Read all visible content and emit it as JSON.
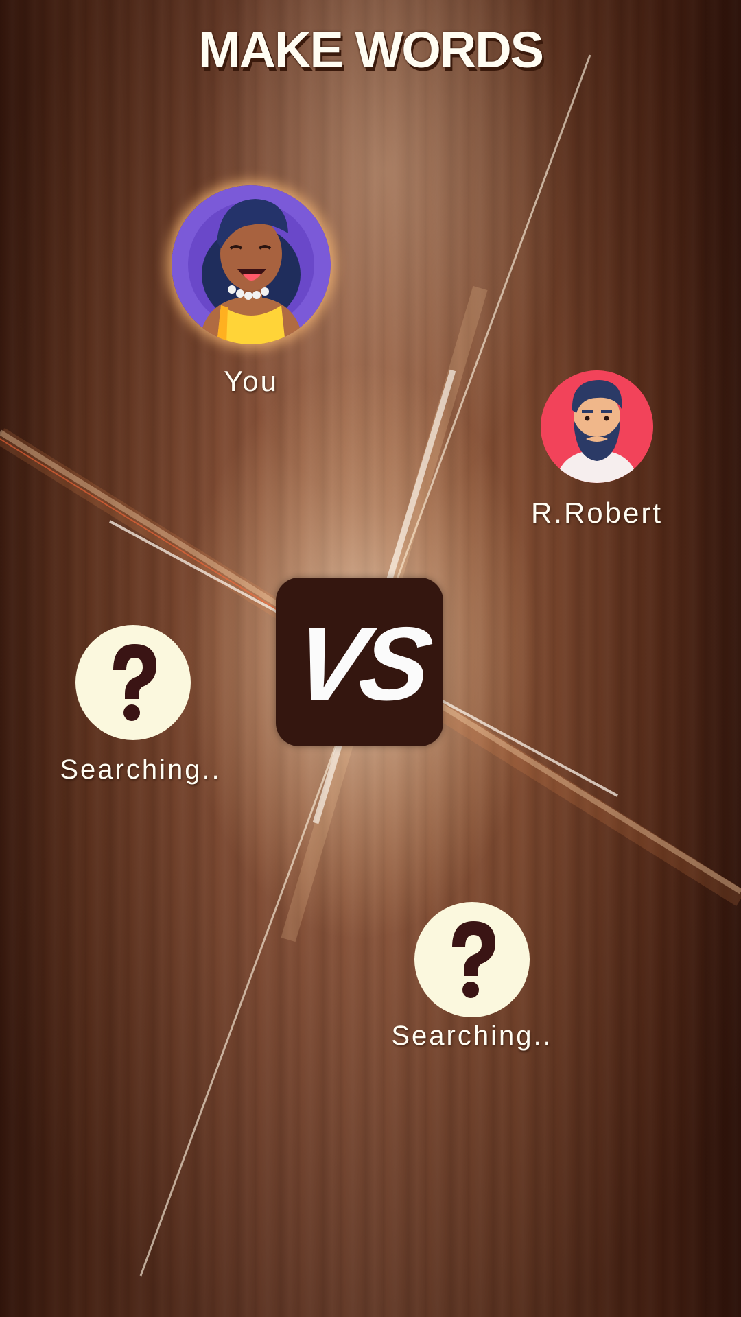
{
  "title": "MAKE WORDS",
  "players": {
    "you": {
      "name": "You",
      "avatar_icon": "woman-avatar-icon"
    },
    "opponent": {
      "name": "R.Robert",
      "avatar_icon": "bearded-man-avatar-icon"
    },
    "slot_left": {
      "status": "Searching..",
      "icon": "question-mark-icon"
    },
    "slot_bottom": {
      "status": "Searching..",
      "icon": "question-mark-icon"
    }
  },
  "versus_label": "VS",
  "colors": {
    "wood_mid": "#a56b4d",
    "wood_dark": "#3e1d10",
    "vs_box": "#34160f",
    "placeholder_circle": "#fbf8de",
    "you_ring": "#7b5ad8",
    "opponent_circle": "#f2435a"
  }
}
